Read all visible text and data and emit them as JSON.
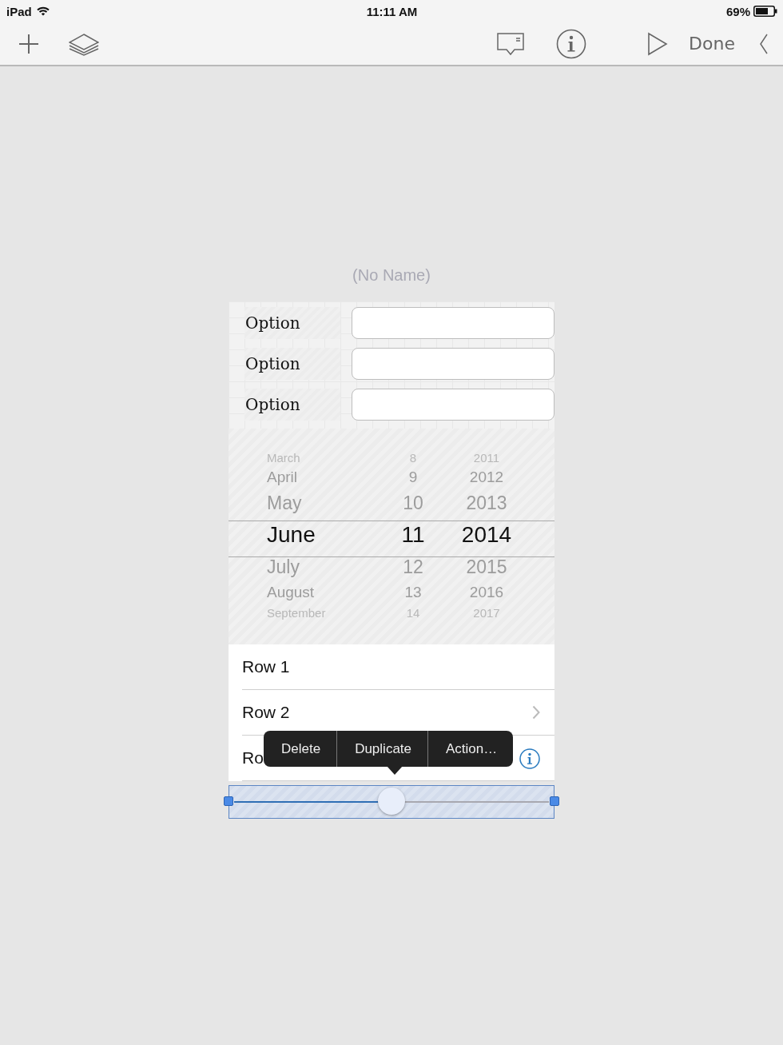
{
  "status_bar": {
    "device": "iPad",
    "time": "11:11 AM",
    "battery": "69%"
  },
  "toolbar": {
    "done": "Done"
  },
  "canvas": {
    "title": "(No Name)",
    "form_rows": [
      {
        "label": "Option"
      },
      {
        "label": "Option"
      },
      {
        "label": "Option"
      }
    ],
    "picker": {
      "columns": [
        {
          "kind": "month",
          "items": [
            {
              "label": "March",
              "selected": false
            },
            {
              "label": "April",
              "selected": false
            },
            {
              "label": "May",
              "selected": false
            },
            {
              "label": "June",
              "selected": true
            },
            {
              "label": "July",
              "selected": false
            },
            {
              "label": "August",
              "selected": false
            },
            {
              "label": "September",
              "selected": false
            }
          ]
        },
        {
          "kind": "day",
          "items": [
            {
              "label": "8",
              "selected": false
            },
            {
              "label": "9",
              "selected": false
            },
            {
              "label": "10",
              "selected": false
            },
            {
              "label": "11",
              "selected": true
            },
            {
              "label": "12",
              "selected": false
            },
            {
              "label": "13",
              "selected": false
            },
            {
              "label": "14",
              "selected": false
            }
          ]
        },
        {
          "kind": "year",
          "items": [
            {
              "label": "2011",
              "selected": false
            },
            {
              "label": "2012",
              "selected": false
            },
            {
              "label": "2013",
              "selected": false
            },
            {
              "label": "2014",
              "selected": true
            },
            {
              "label": "2015",
              "selected": false
            },
            {
              "label": "2016",
              "selected": false
            },
            {
              "label": "2017",
              "selected": false
            }
          ]
        }
      ]
    },
    "table_rows": [
      {
        "label": "Row 1",
        "kind": "plain"
      },
      {
        "label": "Row 2",
        "kind": "chevron"
      },
      {
        "label": "Ro",
        "kind": "info"
      }
    ],
    "context_menu": [
      "Delete",
      "Duplicate",
      "Action…"
    ],
    "slider": {
      "level": 0.5,
      "selected": true
    }
  }
}
